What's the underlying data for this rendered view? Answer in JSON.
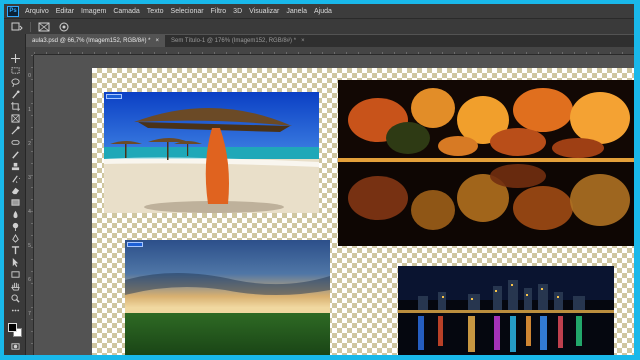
{
  "menu": {
    "logo": "Ps",
    "items": [
      "Arquivo",
      "Editar",
      "Imagem",
      "Camada",
      "Texto",
      "Selecionar",
      "Filtro",
      "3D",
      "Visualizar",
      "Janela",
      "Ajuda"
    ]
  },
  "tabs": [
    {
      "label": "aula3.psd @ 66,7% (Imagem152, RGB/8#) *",
      "close": "×",
      "active": true
    },
    {
      "label": "Sem Título-1 @ 176% (Imagem152, RGB/8#) *",
      "close": "×",
      "active": false
    }
  ],
  "ruler_left_labels": [
    "0",
    "1",
    "2",
    "3",
    "4",
    "5",
    "6",
    "7"
  ],
  "icons": {
    "options": [
      "options-arrow-icon",
      "options-grid-icon",
      "options-target-icon"
    ],
    "tools": [
      "move-tool-icon",
      "marquee-tool-icon",
      "lasso-tool-icon",
      "quick-select-tool-icon",
      "crop-tool-icon",
      "frame-tool-icon",
      "eyedropper-tool-icon",
      "healing-brush-tool-icon",
      "brush-tool-icon",
      "clone-stamp-tool-icon",
      "history-brush-tool-icon",
      "eraser-tool-icon",
      "gradient-tool-icon",
      "blur-tool-icon",
      "dodge-tool-icon",
      "pen-tool-icon",
      "type-tool-icon",
      "path-select-tool-icon",
      "rectangle-tool-icon",
      "hand-tool-icon",
      "zoom-tool-icon",
      "more-tools-icon"
    ]
  },
  "colors": {
    "frame": "#19b8ea",
    "workspace": "#535353",
    "menubar": "#3c3c3c",
    "active_tab": "#535353",
    "layer_badge": "#1c5fd6",
    "checker": "#cfc6a0"
  },
  "photos": [
    "beach-umbrella-photo",
    "autumn-lake-photo",
    "sunset-field-photo",
    "city-night-photo"
  ]
}
